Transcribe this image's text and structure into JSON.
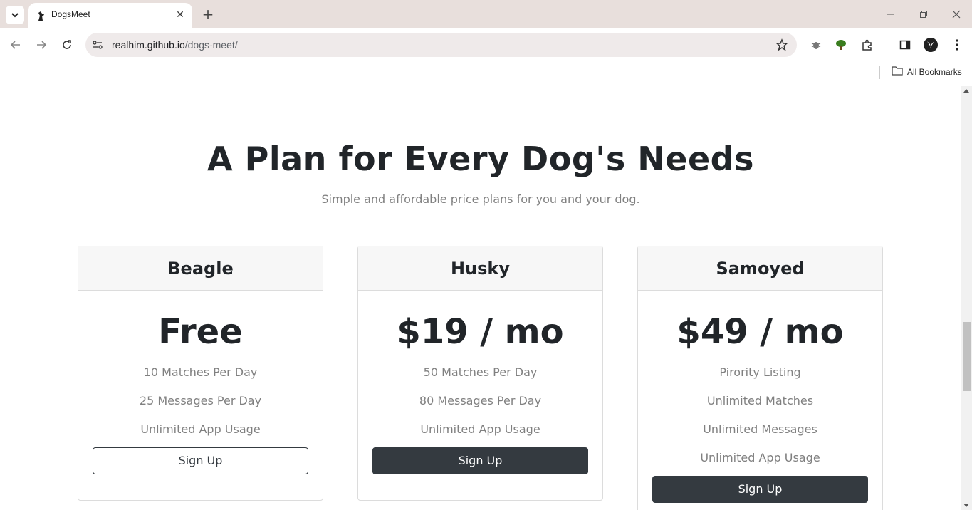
{
  "browser": {
    "tab_title": "DogsMeet",
    "url_host": "realhim.github.io",
    "url_path": "/dogs-meet/",
    "bookmarks_label": "All Bookmarks"
  },
  "page": {
    "heading": "A Plan for Every Dog's Needs",
    "subheading": "Simple and affordable price plans for you and your dog.",
    "plans": [
      {
        "name": "Beagle",
        "price": "Free",
        "features": [
          "10 Matches Per Day",
          "25 Messages Per Day",
          "Unlimited App Usage"
        ],
        "button": "Sign Up",
        "button_style": "outline"
      },
      {
        "name": "Husky",
        "price": "$19 / mo",
        "features": [
          "50 Matches Per Day",
          "80 Messages Per Day",
          "Unlimited App Usage"
        ],
        "button": "Sign Up",
        "button_style": "dark"
      },
      {
        "name": "Samoyed",
        "price": "$49 / mo",
        "features": [
          "Pirority Listing",
          "Unlimited Matches",
          "Unlimited Messages",
          "Unlimited App Usage"
        ],
        "button": "Sign Up",
        "button_style": "dark"
      }
    ]
  },
  "colors": {
    "dark_button": "#343a40",
    "heading_text": "#212529",
    "muted_text": "#808080",
    "card_header_bg": "#f7f7f7"
  },
  "icons": [
    "tab-search-icon",
    "dog-favicon-icon",
    "close-icon",
    "new-tab-icon",
    "minimize-icon",
    "restore-icon",
    "window-close-icon",
    "back-icon",
    "forward-icon",
    "reload-icon",
    "site-info-icon",
    "bookmark-star-icon",
    "bug-extension-icon",
    "tree-extension-icon",
    "extensions-puzzle-icon",
    "side-panel-icon",
    "profile-avatar-icon",
    "menu-kebab-icon",
    "folder-icon"
  ]
}
